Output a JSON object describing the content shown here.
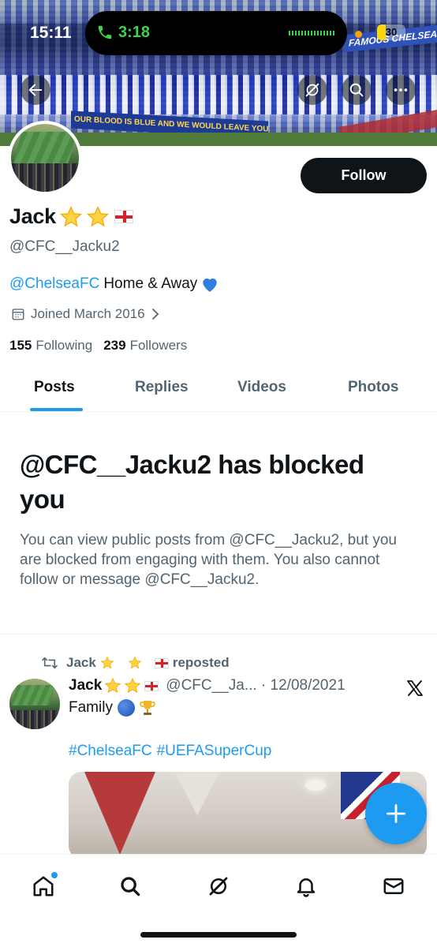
{
  "status_bar": {
    "time": "15:11",
    "call_time": "3:18",
    "battery": "30",
    "battery_level": 0.3
  },
  "banner": {
    "sign_left": "OUR BLOOD IS BLUE AND WE WOULD LEAVE YOU NEVER",
    "sign_right": "FAMOUS CHELSEA"
  },
  "profile": {
    "name": "Jack",
    "handle": "@CFC__Jacku2",
    "bio_mention": "@ChelseaFC",
    "bio_text": "Home & Away",
    "joined": "Joined March 2016",
    "following_count": "155",
    "following_label": "Following",
    "followers_count": "239",
    "followers_label": "Followers",
    "follow_button": "Follow"
  },
  "tabs": [
    {
      "label": "Posts"
    },
    {
      "label": "Replies"
    },
    {
      "label": "Videos"
    },
    {
      "label": "Photos"
    }
  ],
  "blocked": {
    "title": "@CFC__Jacku2 has blocked you",
    "description": "You can view public posts from @CFC__Jacku2, but you are blocked from engaging with them. You also cannot follow or message @CFC__Jacku2."
  },
  "post": {
    "repost_name": "Jack",
    "repost_label": "reposted",
    "author_name": "Jack",
    "author_meta": "@CFC__Ja... · 12/08/2021",
    "text": "Family",
    "hashtags": [
      "#ChelseaFC",
      "#UEFASuperCup"
    ]
  },
  "colors": {
    "accent": "#1d9bf0",
    "text_primary": "#0f1419",
    "text_secondary": "#536471",
    "follow_bg": "#0f1419"
  },
  "icons": {
    "back": "arrow-left-icon",
    "grok": "grok-icon",
    "search": "search-icon",
    "more": "more-icon",
    "calendar": "calendar-icon",
    "repost": "repost-icon",
    "x_logo": "x-logo-icon",
    "compose": "plus-icon",
    "nav": [
      "home-icon",
      "search-icon",
      "grok-icon",
      "bell-icon",
      "mail-icon"
    ]
  }
}
